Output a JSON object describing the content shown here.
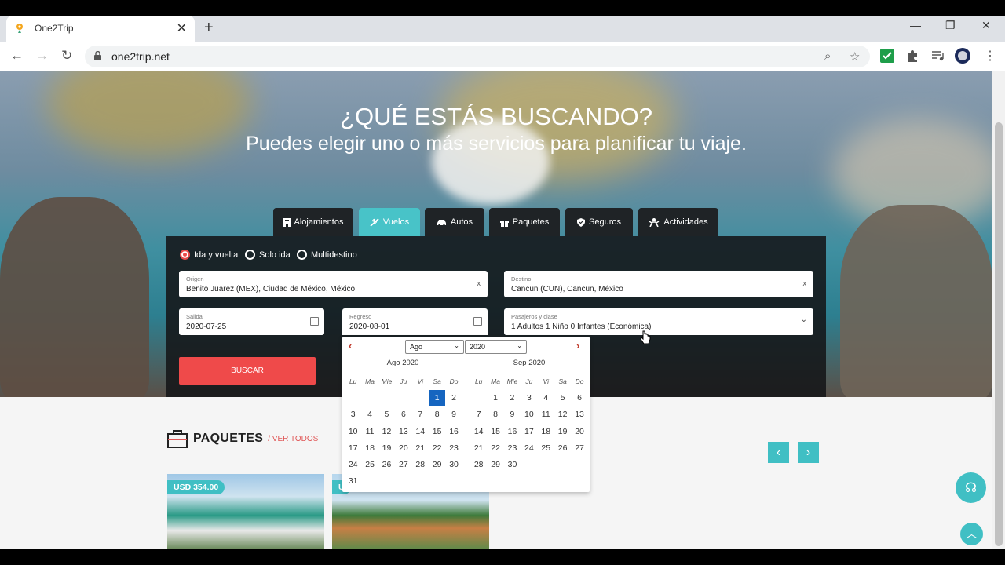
{
  "browser": {
    "tab_title": "One2Trip",
    "tab_close": "✕",
    "new_tab": "+",
    "url": "one2trip.net",
    "window_controls": [
      "—",
      "❐",
      "✕"
    ]
  },
  "hero": {
    "title": "¿QUÉ ESTÁS BUSCANDO?",
    "subtitle": "Puedes elegir uno o más servicios para planificar tu viaje."
  },
  "services": [
    {
      "label": "Alojamientos",
      "icon": "building-icon"
    },
    {
      "label": "Vuelos",
      "icon": "plane-icon",
      "active": true
    },
    {
      "label": "Autos",
      "icon": "car-icon"
    },
    {
      "label": "Paquetes",
      "icon": "gift-icon"
    },
    {
      "label": "Seguros",
      "icon": "shield-icon"
    },
    {
      "label": "Actividades",
      "icon": "activity-icon"
    }
  ],
  "trip_type": [
    {
      "label": "Ida y vuelta",
      "checked": true
    },
    {
      "label": "Solo ida",
      "checked": false
    },
    {
      "label": "Multidestino",
      "checked": false
    }
  ],
  "form": {
    "origin_label": "Origen",
    "origin_value": "Benito Juarez (MEX), Ciudad de México, México",
    "dest_label": "Destino",
    "dest_value": "Cancun (CUN), Cancun, México",
    "clear": "x",
    "depart_label": "Salida",
    "depart_value": "2020-07-25",
    "return_label": "Regreso",
    "return_value": "2020-08-01",
    "pax_label": "Pasajeros y clase",
    "pax_value": "1 Adultos 1 Niño  0 Infantes (Económica)",
    "search_label": "BUSCAR"
  },
  "datepicker": {
    "month_select": "Ago",
    "year_select": "2020",
    "weekdays": [
      "Lu",
      "Ma",
      "Mie",
      "Ju",
      "Vi",
      "Sa",
      "Do"
    ],
    "months": [
      {
        "title": "Ago 2020",
        "lead": 5,
        "days": 31,
        "selected": 1
      },
      {
        "title": "Sep 2020",
        "lead": 1,
        "days": 30,
        "selected": null
      }
    ]
  },
  "packages": {
    "title": "PAQUETES",
    "see_all": "/ VER TODOS",
    "prev": "‹",
    "next": "›",
    "cards": [
      {
        "price": "USD 354.00"
      },
      {
        "price": "U"
      }
    ]
  },
  "colors": {
    "accent": "#40bfc4",
    "search_button": "#ef4a4a",
    "selected_day": "#1565c0",
    "panel": "#141618"
  }
}
